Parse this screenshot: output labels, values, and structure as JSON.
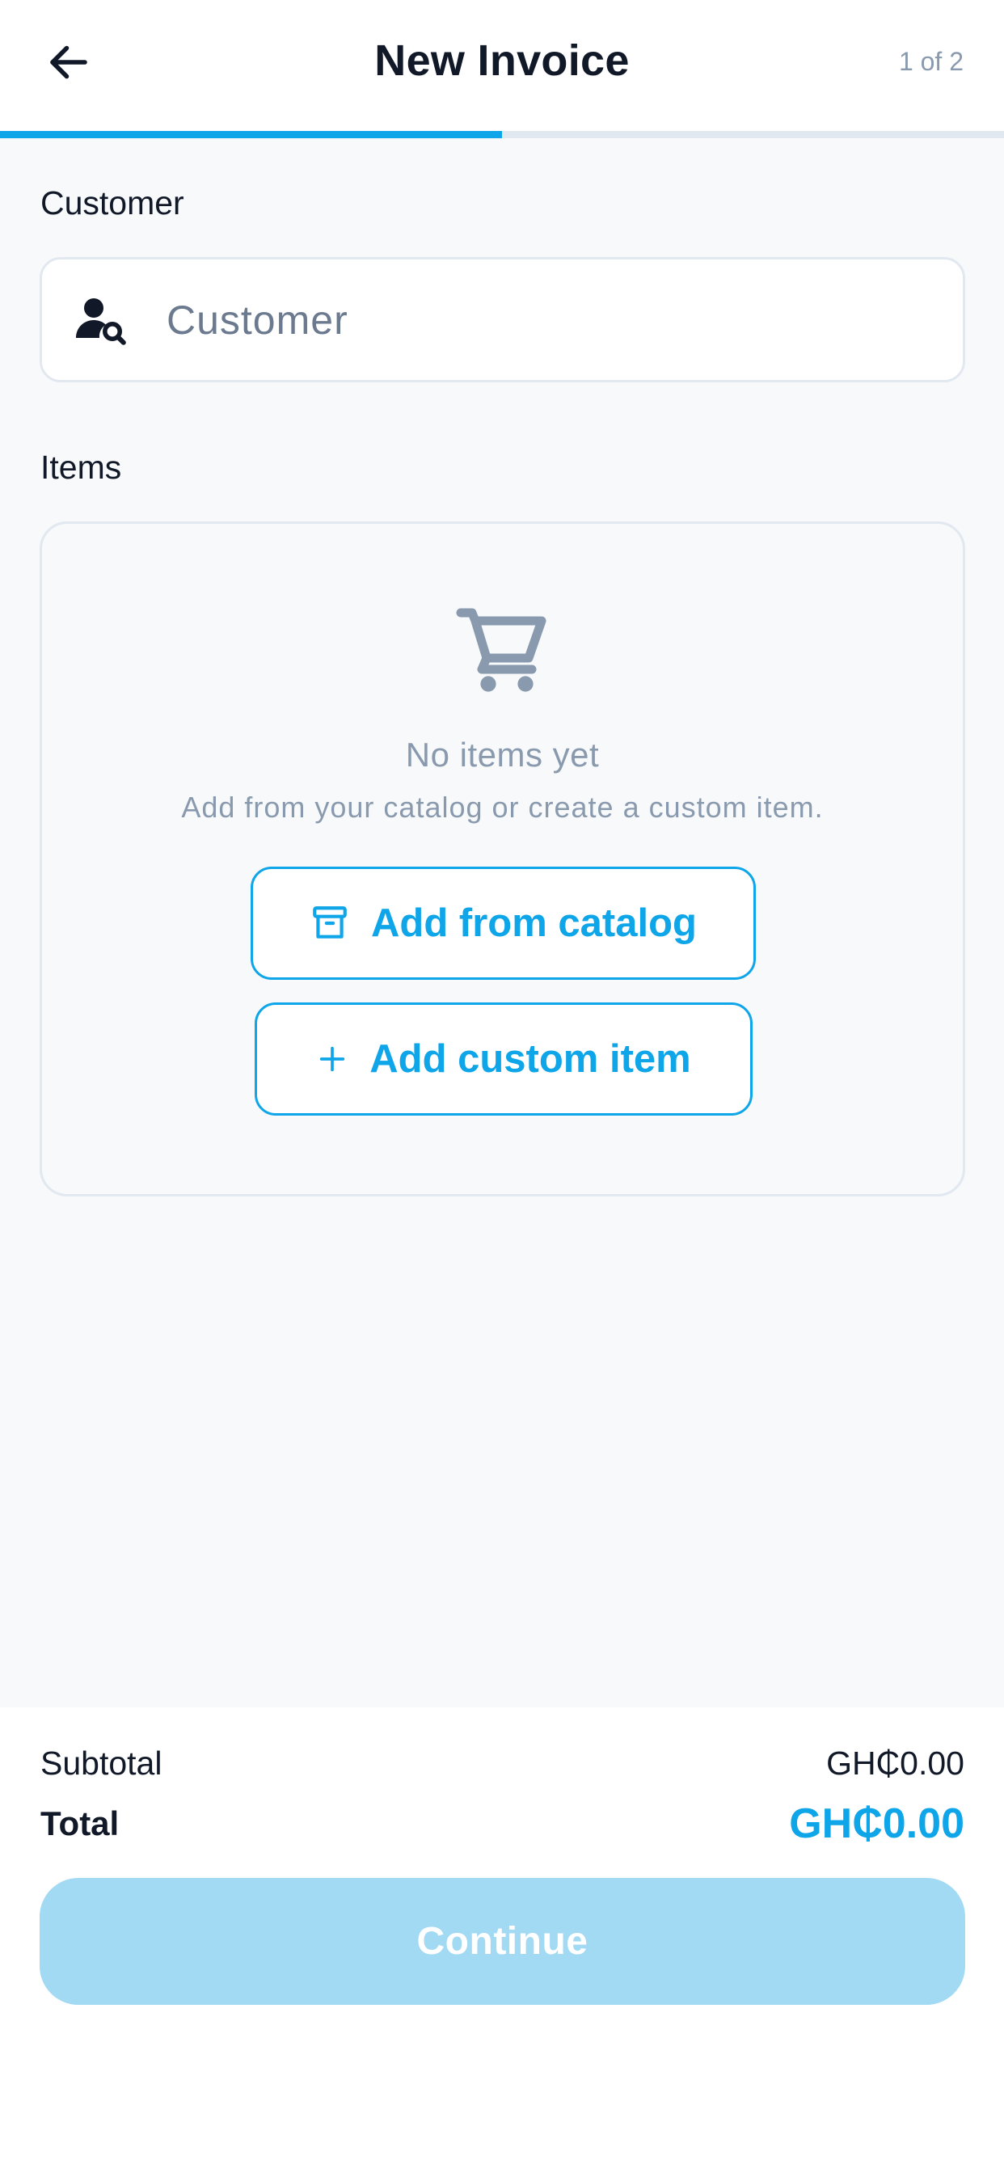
{
  "header": {
    "title": "New Invoice",
    "step": "1 of 2",
    "back_icon": "arrow-left-icon",
    "progress_fraction": 0.5
  },
  "customer": {
    "label": "Customer",
    "placeholder": "Customer",
    "value": "",
    "icon": "user-search-icon"
  },
  "items": {
    "label": "Items",
    "empty_icon": "shopping-cart-icon",
    "empty_title": "No items yet",
    "empty_subtitle": "Add from your catalog or create a custom item.",
    "add_catalog_label": "Add from catalog",
    "add_catalog_icon": "archive-box-icon",
    "add_custom_label": "Add custom item",
    "add_custom_icon": "plus-icon"
  },
  "summary": {
    "subtotal_label": "Subtotal",
    "subtotal_value": "GH₵0.00",
    "total_label": "Total",
    "total_value": "GH₵0.00"
  },
  "actions": {
    "continue_label": "Continue",
    "continue_enabled": false
  },
  "colors": {
    "accent": "#0ea5e9",
    "accent_disabled": "#a2daf4",
    "text_primary": "#111827",
    "text_muted": "#8a9aae",
    "border": "#e2e8f0",
    "background": "#f7f9fb"
  }
}
